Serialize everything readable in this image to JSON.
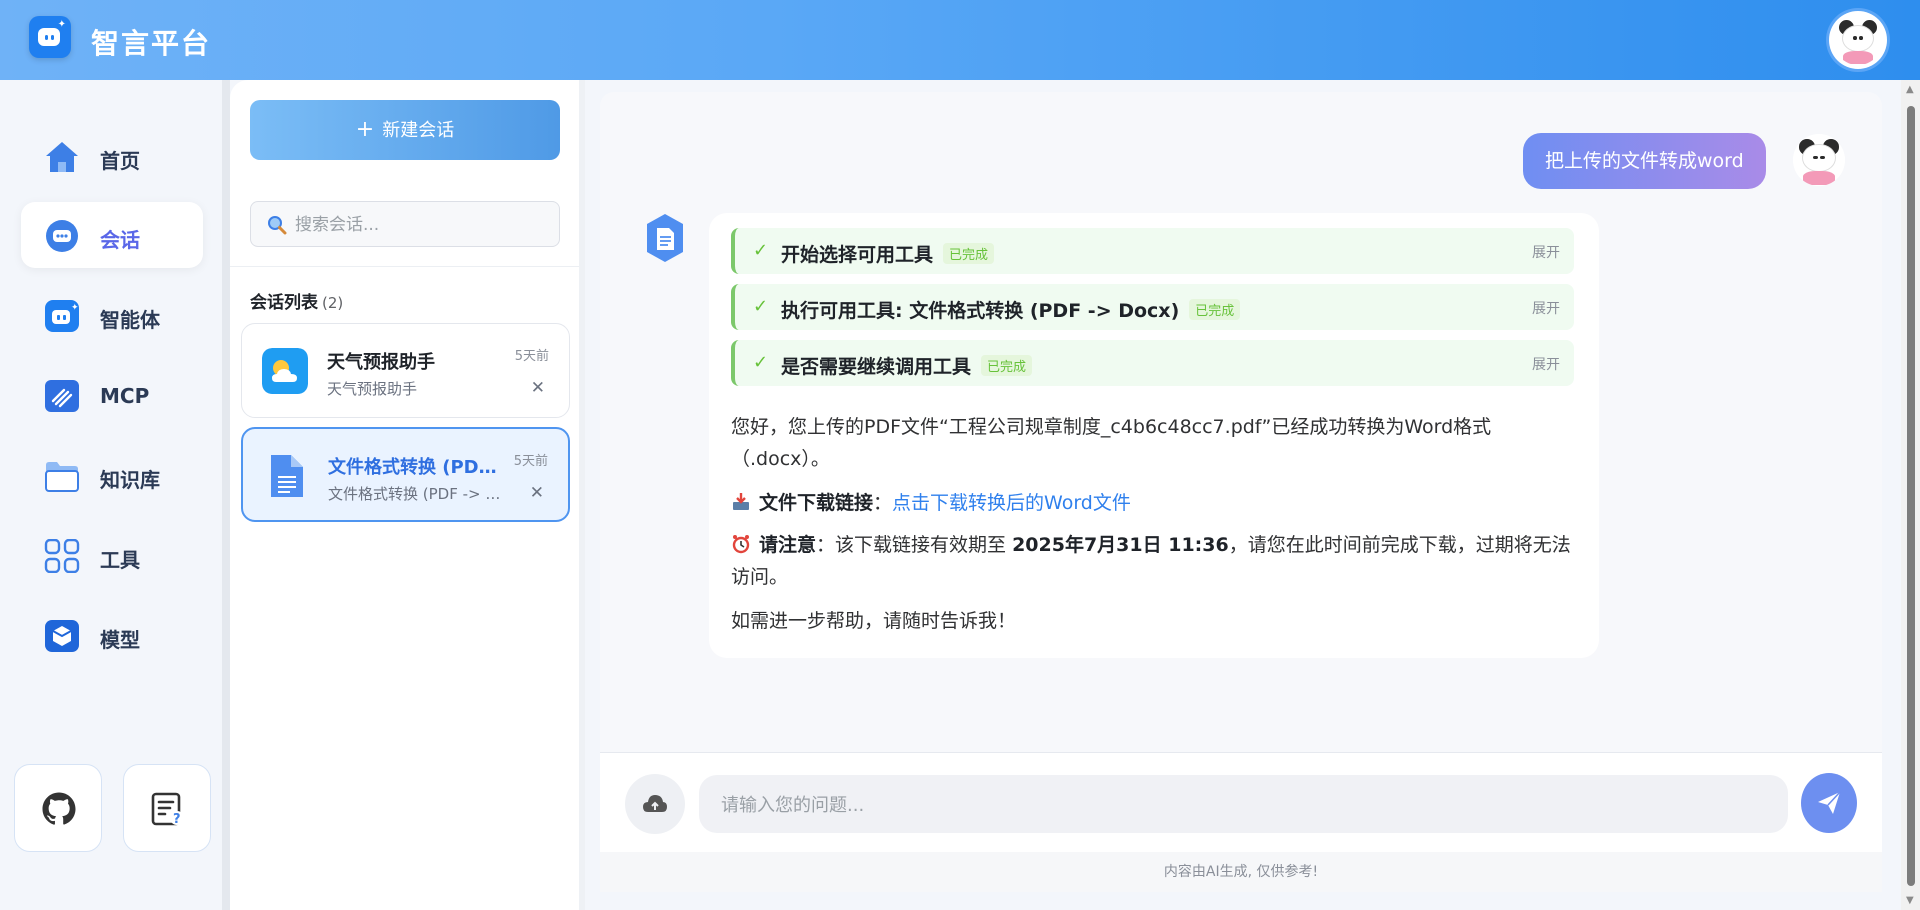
{
  "app": {
    "title": "智言平台"
  },
  "nav": {
    "items": [
      {
        "label": "首页",
        "icon": "home-icon"
      },
      {
        "label": "会话",
        "icon": "chat-icon",
        "active": true
      },
      {
        "label": "智能体",
        "icon": "robot-icon"
      },
      {
        "label": "MCP",
        "icon": "mcp-icon"
      },
      {
        "label": "知识库",
        "icon": "folder-icon"
      },
      {
        "label": "工具",
        "icon": "grid-icon"
      },
      {
        "label": "模型",
        "icon": "cube-icon"
      }
    ],
    "bottom": [
      {
        "icon": "github-icon"
      },
      {
        "icon": "help-doc-icon"
      }
    ]
  },
  "sessions": {
    "new_chat_label": "新建会话",
    "search_placeholder": "搜索会话...",
    "list_title": "会话列表",
    "list_count": "(2)",
    "items": [
      {
        "title": "天气预报助手",
        "subtitle": "天气预报助手",
        "time": "5天前",
        "icon": "weather-icon"
      },
      {
        "title": "文件格式转换 (PDF -> Docx)",
        "subtitle": "文件格式转换 (PDF -> Docx)",
        "time": "5天前",
        "icon": "document-icon",
        "active": true
      }
    ]
  },
  "chat": {
    "user_message": "把上传的文件转成word",
    "steps": [
      {
        "label": "开始选择可用工具",
        "status": "已完成",
        "expand": "展开"
      },
      {
        "label": "执行可用工具: 文件格式转换 (PDF -> Docx)",
        "status": "已完成",
        "expand": "展开"
      },
      {
        "label": "是否需要继续调用工具",
        "status": "已完成",
        "expand": "展开"
      }
    ],
    "reply": {
      "p1": "您好，您上传的PDF文件“工程公司规章制度_c4b6c48cc7.pdf”已经成功转换为Word格式（.docx）。",
      "download_label": "文件下载链接",
      "download_link": "点击下载转换后的Word文件",
      "notice_label": "请注意",
      "notice_before": "：该下载链接有效期至 ",
      "notice_time": "2025年7月31日 11:36",
      "notice_after": "，请您在此时间前完成下载，过期将无法访问。",
      "p4": "如需进一步帮助，请随时告诉我！"
    },
    "input_placeholder": "请输入您的问题...",
    "footer_note": "内容由AI生成, 仅供参考!"
  },
  "colors": {
    "accent": "#5a67e8",
    "header_start": "#6fb2f7",
    "header_end": "#2e8eee",
    "done_green": "#67c23a",
    "link": "#2f80ed"
  }
}
